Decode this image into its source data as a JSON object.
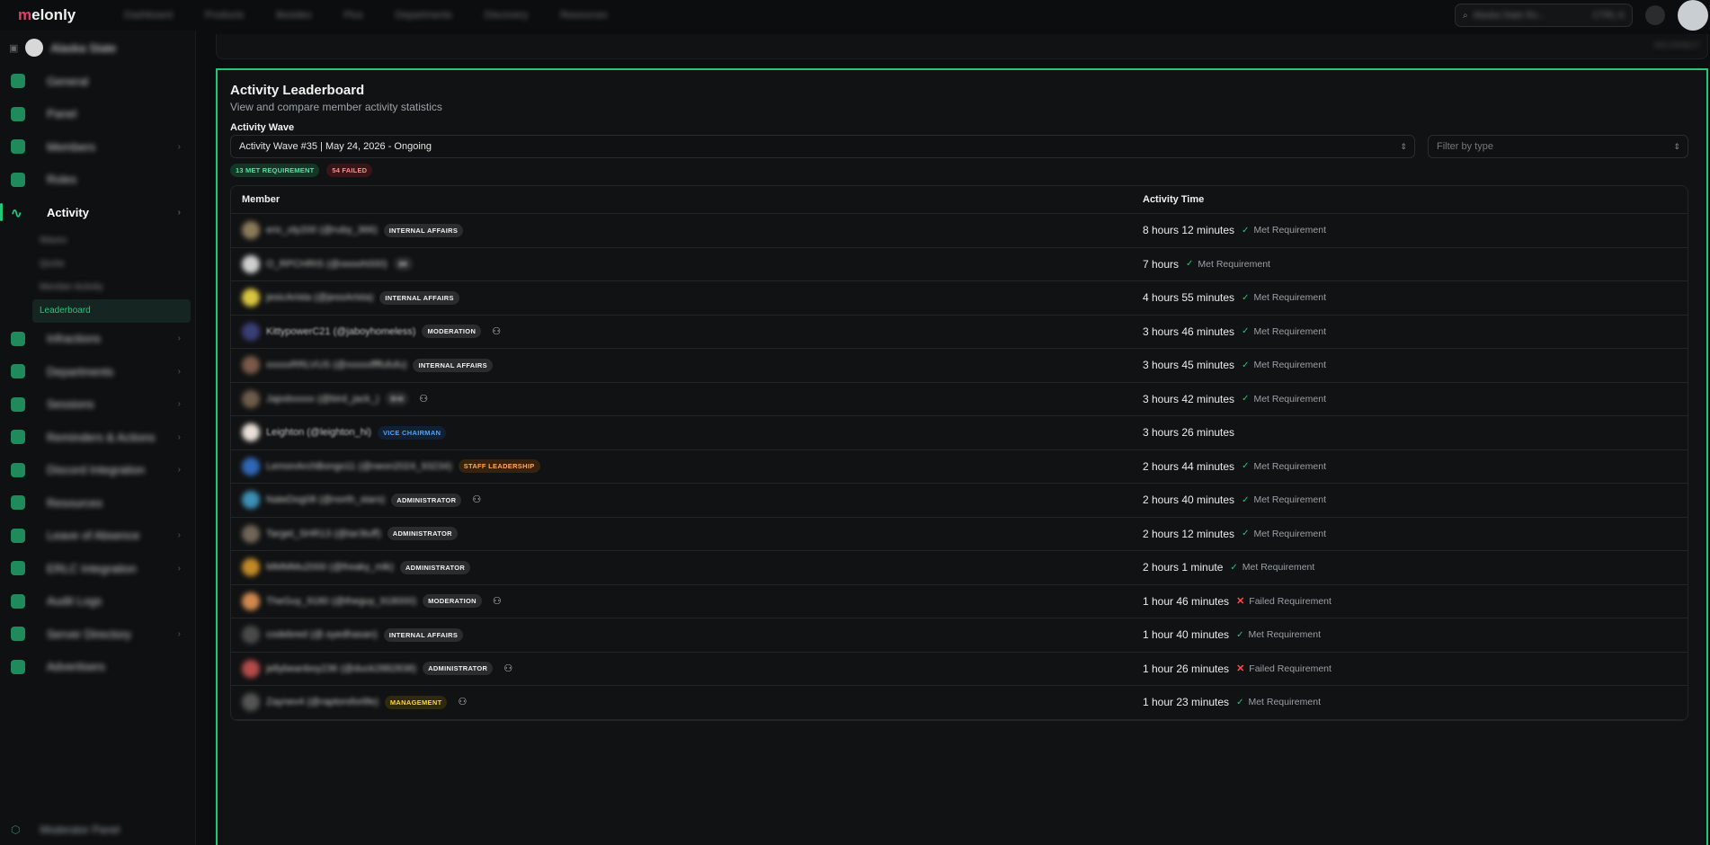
{
  "topbar": {
    "brand_prefix": "m",
    "brand_rest": "elonly",
    "nav": [
      "Dashboard",
      "Products",
      "Besides",
      "Plus",
      "Departments",
      "Discovery",
      "Resources"
    ],
    "search_text": "Alaska State Ro...",
    "search_shortcut": "CTRL K"
  },
  "sidebar": {
    "server_name": "Alaska State",
    "items": [
      {
        "label": "General"
      },
      {
        "label": "Panel"
      },
      {
        "label": "Members"
      },
      {
        "label": "Roles"
      },
      {
        "label": "Activity"
      },
      {
        "label": "Infractions"
      },
      {
        "label": "Departments"
      },
      {
        "label": "Sessions"
      },
      {
        "label": "Reminders & Actions"
      },
      {
        "label": "Discord Integration"
      },
      {
        "label": "Resources"
      },
      {
        "label": "Leave of Absence"
      },
      {
        "label": "ERLC Integration"
      },
      {
        "label": "Audit Logs"
      },
      {
        "label": "Server Directory"
      },
      {
        "label": "Advertisers"
      }
    ],
    "activity_sub": [
      "Waves",
      "Quota",
      "Member Activity",
      "Leaderboard"
    ],
    "bottom_label": "Moderator Panel"
  },
  "prev_card_right": "RECONNECT",
  "panel": {
    "title": "Activity Leaderboard",
    "subtitle": "View and compare member activity statistics",
    "wave_label": "Activity Wave",
    "wave_value": "Activity Wave #35 | May 24, 2026 - Ongoing",
    "filter_placeholder": "Filter by type",
    "met_badge": "13 MET REQUIREMENT",
    "failed_badge": "54 FAILED",
    "col_member": "Member",
    "col_time": "Activity Time"
  },
  "rows": [
    {
      "name": "eric_oly200 (@ruby_366)",
      "role": "INTERNAL AFFAIRS",
      "role_style": "",
      "icon": false,
      "time": "8 hours 12 minutes",
      "status": "Met Requirement",
      "met": true,
      "avatar": "#8a7a5a"
    },
    {
      "name": "O_RPCHRIS (@ooooh000)",
      "role": "24",
      "role_style": "grey",
      "icon": false,
      "time": "7 hours",
      "status": "Met Requirement",
      "met": true,
      "avatar": "#cfcfcf"
    },
    {
      "name": "jesicArista (@jessArista)",
      "role": "INTERNAL AFFAIRS",
      "role_style": "",
      "icon": false,
      "time": "4 hours 55 minutes",
      "status": "Met Requirement",
      "met": true,
      "avatar": "#d9c641"
    },
    {
      "name": "KittypowerC21 (@jaboyhomeless)",
      "role": "MODERATION",
      "role_style": "",
      "icon": true,
      "time": "3 hours 46 minutes",
      "status": "Met Requirement",
      "met": true,
      "avatar": "#3b3f78"
    },
    {
      "name": "xxxxxRRLVUS (@xxxxxffffufufu)",
      "role": "INTERNAL AFFAIRS",
      "role_style": "",
      "icon": false,
      "time": "3 hours 45 minutes",
      "status": "Met Requirement",
      "met": true,
      "avatar": "#7a5a48"
    },
    {
      "name": "Jajodxxxxx (@bird_jack_)",
      "role": "3+4",
      "role_style": "grey",
      "icon": true,
      "time": "3 hours 42 minutes",
      "status": "Met Requirement",
      "met": true,
      "avatar": "#6e5c4b"
    },
    {
      "name": "Leighton (@leighton_hi)",
      "role": "VICE CHAIRMAN",
      "role_style": "blue",
      "icon": false,
      "time": "3 hours 26 minutes",
      "status": "",
      "met": null,
      "avatar": "#e9e1d9"
    },
    {
      "name": "LemonArchBongo11 (@neon2024_93234)",
      "role": "STAFF LEADERSHIP",
      "role_style": "orange",
      "icon": false,
      "time": "2 hours 44 minutes",
      "status": "Met Requirement",
      "met": true,
      "avatar": "#2f68b8"
    },
    {
      "name": "NateDog08 (@north_stars)",
      "role": "ADMINISTRATOR",
      "role_style": "",
      "icon": true,
      "time": "2 hours 40 minutes",
      "status": "Met Requirement",
      "met": true,
      "avatar": "#3c8fb5"
    },
    {
      "name": "Target_SHR13 (@tar3tuff)",
      "role": "ADMINISTRATOR",
      "role_style": "",
      "icon": false,
      "time": "2 hours 12 minutes",
      "status": "Met Requirement",
      "met": true,
      "avatar": "#6f6658"
    },
    {
      "name": "MMMMu2000 (@freaky_mlk)",
      "role": "ADMINISTRATOR",
      "role_style": "",
      "icon": false,
      "time": "2 hours 1 minute",
      "status": "Met Requirement",
      "met": true,
      "avatar": "#c08a28"
    },
    {
      "name": "TheGuy_9180 (@theguy_918000)",
      "role": "MODERATION",
      "role_style": "",
      "icon": true,
      "time": "1 hour 46 minutes",
      "status": "Failed Requirement",
      "met": false,
      "avatar": "#d08850"
    },
    {
      "name": "codebred (@.syedhasan)",
      "role": "INTERNAL AFFAIRS",
      "role_style": "",
      "icon": false,
      "time": "1 hour 40 minutes",
      "status": "Met Requirement",
      "met": true,
      "avatar": "#4a4a4a"
    },
    {
      "name": "jellybeanboy236 (@duck2882838)",
      "role": "ADMINISTRATOR",
      "role_style": "",
      "icon": true,
      "time": "1 hour 26 minutes",
      "status": "Failed Requirement",
      "met": false,
      "avatar": "#b54a4a"
    },
    {
      "name": "Zaynev4 (@raptorsforlife)",
      "role": "MANAGEMENT",
      "role_style": "yellow",
      "icon": true,
      "time": "1 hour 23 minutes",
      "status": "Met Requirement",
      "met": true,
      "avatar": "#555555"
    }
  ]
}
